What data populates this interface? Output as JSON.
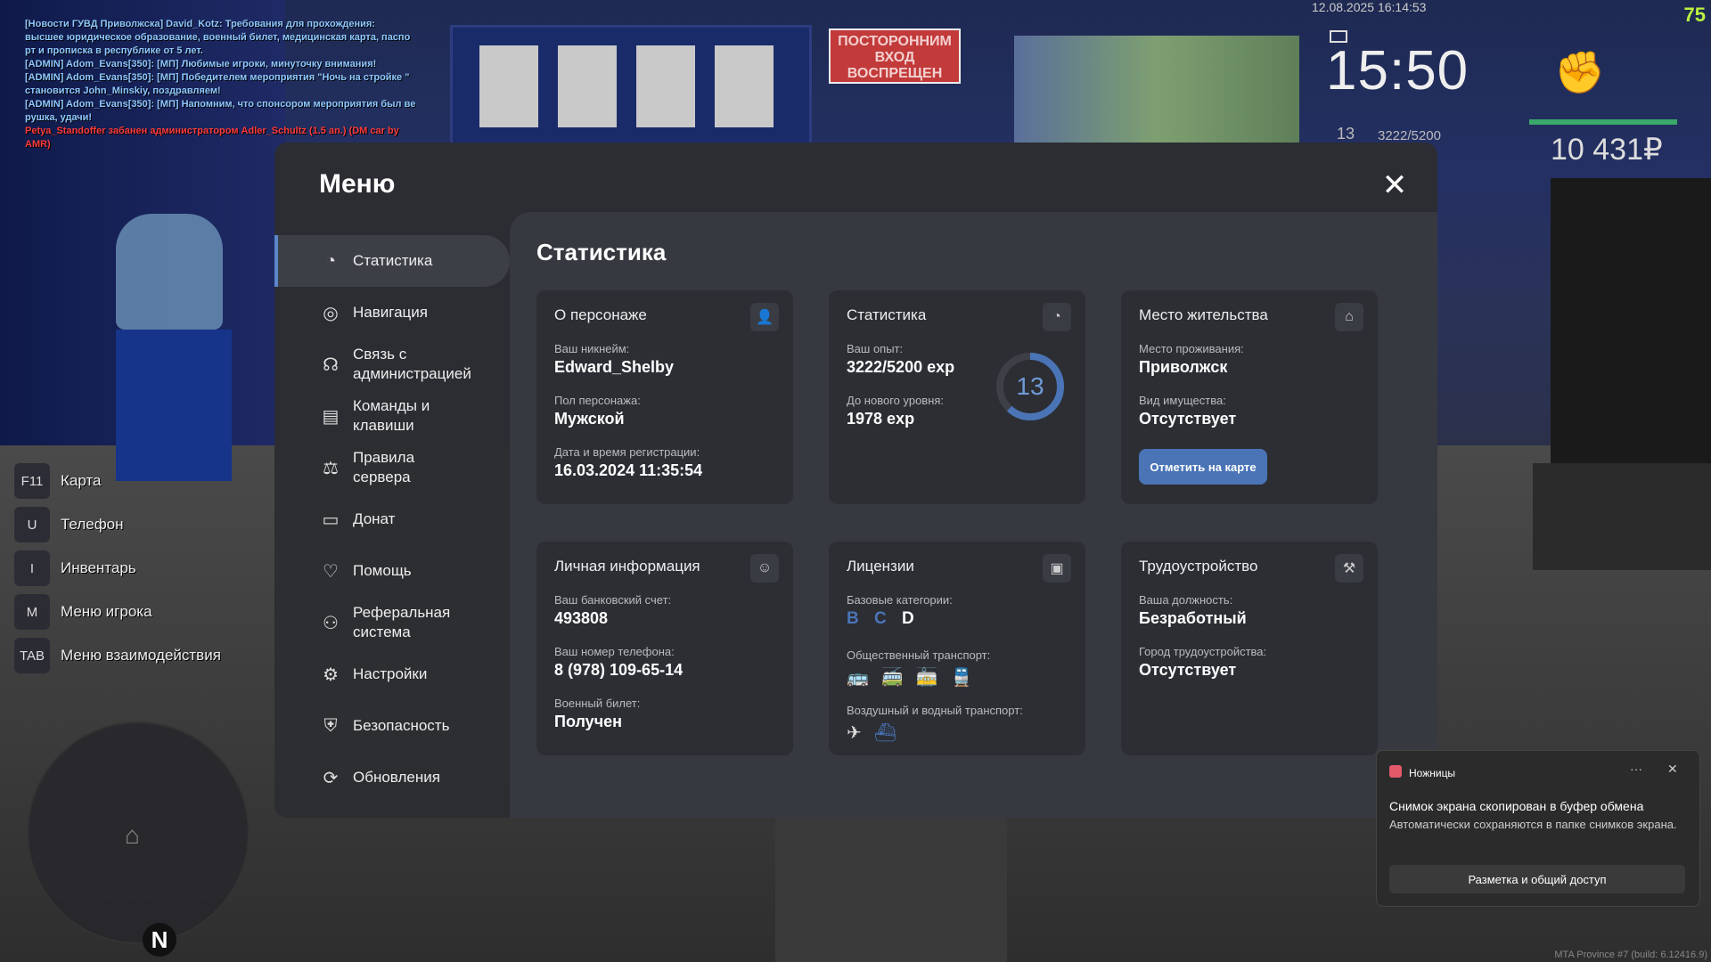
{
  "chat": [
    {
      "text": "[Новости ГУВД Приволжска] David_Kotz: Требования для прохождения:",
      "color": "blue"
    },
    {
      "text": " высшее юридическое образование, военный билет, медицинская карта, паспо",
      "color": "blue"
    },
    {
      "text": "рт и прописка в республике от 5 лет.",
      "color": "blue"
    },
    {
      "text": "[ADMIN] Adom_Evans[350]: [МП] Любимые игроки, минуточку внимания!",
      "color": "blue"
    },
    {
      "text": "[ADMIN] Adom_Evans[350]: [МП] Победителем мероприятия \"Ночь на стройке \"",
      "color": "blue"
    },
    {
      "text": " становится John_Minskiy, поздравляем!",
      "color": "blue"
    },
    {
      "text": "[ADMIN] Adom_Evans[350]: [МП] Напомним, что спонсором мероприятия был ве",
      "color": "blue"
    },
    {
      "text": "рушка, удачи!",
      "color": "blue"
    },
    {
      "text": "Petya_Standoffer забанен администратором Adler_Schultz (1.5 an.) (DM car by",
      "color": "red"
    },
    {
      "text": " AMR)",
      "color": "red"
    }
  ],
  "background": {
    "sign_text": "ПОСТОРОННИМ ВХОД ВОСПРЕЩЕН"
  },
  "hud": {
    "fps": "75",
    "datetime": "12.08.2025 16:14:53",
    "clock": "15:50",
    "level": "13",
    "exp": "3222/5200",
    "money": "10 431₽"
  },
  "hotkeys": [
    {
      "key": "F11",
      "label": "Карта"
    },
    {
      "key": "U",
      "label": "Телефон"
    },
    {
      "key": "I",
      "label": "Инвентарь"
    },
    {
      "key": "M",
      "label": "Меню игрока"
    },
    {
      "key": "TAB",
      "label": "Меню взаимодействия"
    }
  ],
  "radar": {
    "north": "N"
  },
  "menu": {
    "title": "Меню",
    "close": "✕",
    "nav": [
      {
        "label": "Статистика",
        "icon": "pie-chart-icon",
        "glyph": "◔"
      },
      {
        "label": "Навигация",
        "icon": "compass-icon",
        "glyph": "◎"
      },
      {
        "label": "Связь с администрацией",
        "icon": "headset-icon",
        "glyph": "☊"
      },
      {
        "label": "Команды и клавиши",
        "icon": "document-icon",
        "glyph": "▤"
      },
      {
        "label": "Правила сервера",
        "icon": "scales-icon",
        "glyph": "⚖"
      },
      {
        "label": "Донат",
        "icon": "wallet-icon",
        "glyph": "▭"
      },
      {
        "label": "Помощь",
        "icon": "handshake-icon",
        "glyph": "♡"
      },
      {
        "label": "Реферальная система",
        "icon": "network-icon",
        "glyph": "⚇"
      },
      {
        "label": "Настройки",
        "icon": "gear-icon",
        "glyph": "⚙"
      },
      {
        "label": "Безопасность",
        "icon": "shield-icon",
        "glyph": "⛨"
      },
      {
        "label": "Обновления",
        "icon": "refresh-check-icon",
        "glyph": "⟳"
      }
    ],
    "content_title": "Статистика",
    "cards": {
      "character": {
        "title": "О персонаже",
        "f1_label": "Ваш никнейм:",
        "f1_value": "Edward_Shelby",
        "f2_label": "Пол персонажа:",
        "f2_value": "Мужской",
        "f3_label": "Дата и время регистрации:",
        "f3_value": "16.03.2024 11:35:54"
      },
      "stats": {
        "title": "Статистика",
        "f1_label": "Ваш опыт:",
        "f1_value": "3222/5200 exp",
        "f2_label": "До нового уровня:",
        "f2_value": "1978 exp",
        "level": "13",
        "progress": 0.6196
      },
      "residence": {
        "title": "Место жительства",
        "f1_label": "Место проживания:",
        "f1_value": "Приволжск",
        "f2_label": "Вид имущества:",
        "f2_value": "Отсутствует",
        "button": "Отметить на карте"
      },
      "personal": {
        "title": "Личная информация",
        "f1_label": "Ваш банковский счет:",
        "f1_value": "493808",
        "f2_label": "Ваш номер телефона:",
        "f2_value": "8 (978) 109-65-14",
        "f3_label": "Военный билет:",
        "f3_value": "Получен"
      },
      "licenses": {
        "title": "Лицензии",
        "base_label": "Базовые категории:",
        "categories": [
          {
            "letter": "B",
            "color": "#4a74b6"
          },
          {
            "letter": "C",
            "color": "#4a74b6"
          },
          {
            "letter": "D",
            "color": "#ffffff"
          }
        ],
        "public_label": "Общественный транспорт:",
        "air_label": "Воздушный и водный транспорт:"
      },
      "employment": {
        "title": "Трудоустройство",
        "f1_label": "Ваша должность:",
        "f1_value": "Безработный",
        "f2_label": "Город трудоустройства:",
        "f2_value": "Отсутствует"
      }
    }
  },
  "toast": {
    "app": "Ножницы",
    "dots": "···",
    "close": "✕",
    "heading": "Снимок экрана скопирован в буфер обмена",
    "body": "Автоматически сохраняются в папке снимков экрана.",
    "action": "Разметка и общий доступ"
  },
  "build": "MTA Province #7 (build: 6.12416.9)",
  "colors": {
    "accent": "#4a74b6",
    "active_bar": "#5b86c9",
    "hp": "#3aa86a",
    "fps": "#b9f33f"
  }
}
